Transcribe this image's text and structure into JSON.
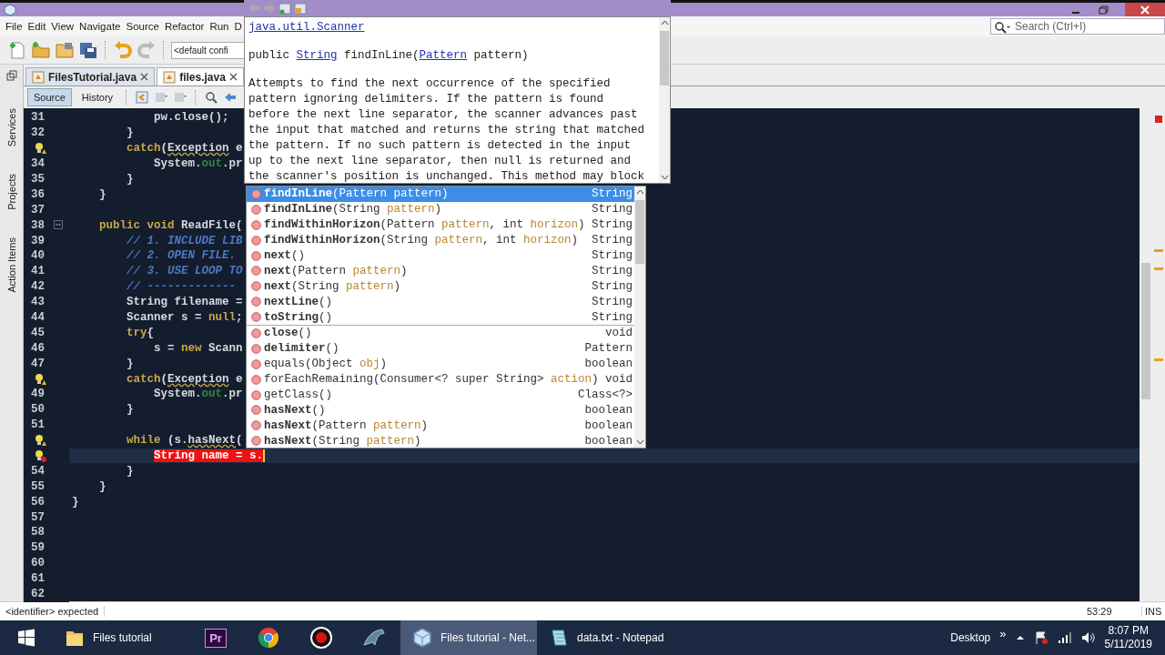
{
  "menu": [
    "File",
    "Edit",
    "View",
    "Navigate",
    "Source",
    "Refactor",
    "Run",
    "D"
  ],
  "toolbar": {
    "config": "<default confi"
  },
  "search": {
    "placeholder": "Search (Ctrl+I)"
  },
  "side_tabs": [
    "Services",
    "Projects",
    "Action Items"
  ],
  "editor_tabs": [
    {
      "label": "FilesTutorial.java",
      "selected": false
    },
    {
      "label": "files.java",
      "selected": true
    }
  ],
  "view_tabs": [
    {
      "label": "Source",
      "selected": true
    },
    {
      "label": "History",
      "selected": false
    }
  ],
  "code_lines": [
    {
      "number": "31",
      "tokens": [
        {
          "kind": "plain",
          "text": "            pw.close();"
        }
      ]
    },
    {
      "number": "32",
      "tokens": [
        {
          "kind": "plain",
          "text": "        }"
        }
      ]
    },
    {
      "warning": true,
      "tokens": [
        {
          "kind": "keyword",
          "text": "        catch"
        },
        {
          "kind": "plain",
          "text": "("
        },
        {
          "kind": "squiggle",
          "text": "Exception"
        },
        {
          "kind": "plain",
          "text": " e"
        }
      ]
    },
    {
      "number": "34",
      "tokens": [
        {
          "kind": "plain",
          "text": "            System."
        },
        {
          "kind": "field",
          "text": "out"
        },
        {
          "kind": "plain",
          "text": ".pr"
        }
      ]
    },
    {
      "number": "35",
      "tokens": [
        {
          "kind": "plain",
          "text": "        }"
        }
      ]
    },
    {
      "number": "36",
      "tokens": [
        {
          "kind": "plain",
          "text": "    }"
        }
      ]
    },
    {
      "number": "37"
    },
    {
      "number": "38",
      "fold": true,
      "tokens": [
        {
          "kind": "keyword",
          "text": "    public void"
        },
        {
          "kind": "plain",
          "text": " ReadFile("
        }
      ]
    },
    {
      "number": "39",
      "tokens": [
        {
          "kind": "comment",
          "text": "        // 1. INCLUDE LIB"
        }
      ]
    },
    {
      "number": "40",
      "tokens": [
        {
          "kind": "comment",
          "text": "        // 2. OPEN FILE."
        }
      ]
    },
    {
      "number": "41",
      "tokens": [
        {
          "kind": "comment",
          "text": "        // 3. USE LOOP TO"
        }
      ]
    },
    {
      "number": "42",
      "tokens": [
        {
          "kind": "comment",
          "text": "        // -------------"
        }
      ]
    },
    {
      "number": "43",
      "tokens": [
        {
          "kind": "plain",
          "text": "        String filename ="
        }
      ]
    },
    {
      "number": "44",
      "tokens": [
        {
          "kind": "plain",
          "text": "        Scanner s = "
        },
        {
          "kind": "keyword",
          "text": "null"
        },
        {
          "kind": "plain",
          "text": ";"
        }
      ]
    },
    {
      "number": "45",
      "tokens": [
        {
          "kind": "keyword",
          "text": "        try"
        },
        {
          "kind": "plain",
          "text": "{"
        }
      ]
    },
    {
      "number": "46",
      "tokens": [
        {
          "kind": "plain",
          "text": "            s = "
        },
        {
          "kind": "keyword",
          "text": "new"
        },
        {
          "kind": "plain",
          "text": " Scann"
        }
      ]
    },
    {
      "number": "47",
      "tokens": [
        {
          "kind": "plain",
          "text": "        }"
        }
      ]
    },
    {
      "warning": true,
      "tokens": [
        {
          "kind": "keyword",
          "text": "        catch"
        },
        {
          "kind": "plain",
          "text": "("
        },
        {
          "kind": "squiggle",
          "text": "Exception"
        },
        {
          "kind": "plain",
          "text": " e"
        }
      ]
    },
    {
      "number": "49",
      "tokens": [
        {
          "kind": "plain",
          "text": "            System."
        },
        {
          "kind": "field",
          "text": "out"
        },
        {
          "kind": "plain",
          "text": ".pr"
        }
      ]
    },
    {
      "number": "50",
      "tokens": [
        {
          "kind": "plain",
          "text": "        }"
        }
      ]
    },
    {
      "number": "51"
    },
    {
      "warning": true,
      "tokens": [
        {
          "kind": "keyword",
          "text": "        while"
        },
        {
          "kind": "plain",
          "text": " (s."
        },
        {
          "kind": "squiggle",
          "text": "hasNext"
        },
        {
          "kind": "plain",
          "text": "("
        }
      ]
    },
    {
      "error": true,
      "current": true,
      "tokens": [
        {
          "kind": "error",
          "text": "String name = s."
        }
      ]
    },
    {
      "number": "54",
      "tokens": [
        {
          "kind": "plain",
          "text": "        }"
        }
      ]
    },
    {
      "number": "55",
      "tokens": [
        {
          "kind": "plain",
          "text": "    }"
        }
      ]
    },
    {
      "number": "56",
      "tokens": [
        {
          "kind": "plain",
          "text": "}"
        }
      ]
    },
    {
      "number": "57"
    },
    {
      "number": "58"
    },
    {
      "number": "59"
    },
    {
      "number": "60"
    },
    {
      "number": "61"
    },
    {
      "number": "62"
    }
  ],
  "javadoc": {
    "class_link": "java.util.Scanner",
    "signature": [
      {
        "kind": "plain",
        "text": "public "
      },
      {
        "kind": "link",
        "text": "String"
      },
      {
        "kind": "plain",
        "text": " findInLine("
      },
      {
        "kind": "link",
        "text": "Pattern"
      },
      {
        "kind": "plain",
        "text": " pattern)"
      }
    ],
    "description": "Attempts to find the next occurrence of the specified pattern ignoring delimiters. If the pattern is found before the next line separator, the scanner advances past the input that matched and returns the string that matched the pattern. If no such pattern is detected in the input up to the next line separator, then null is returned and the scanner's position is unchanged. This method may block"
  },
  "completion": {
    "groups": [
      [
        {
          "selected": true,
          "inherited": false,
          "returns": "String",
          "parts": [
            {
              "kind": "name",
              "text": "findInLine"
            },
            {
              "kind": "plain",
              "text": "(Pattern "
            },
            {
              "kind": "param",
              "text": "pattern"
            },
            {
              "kind": "plain",
              "text": ")"
            }
          ]
        },
        {
          "selected": false,
          "inherited": false,
          "returns": "String",
          "parts": [
            {
              "kind": "name",
              "text": "findInLine"
            },
            {
              "kind": "plain",
              "text": "(String "
            },
            {
              "kind": "param",
              "text": "pattern"
            },
            {
              "kind": "plain",
              "text": ")"
            }
          ]
        },
        {
          "selected": false,
          "inherited": false,
          "returns": "String",
          "parts": [
            {
              "kind": "name",
              "text": "findWithinHorizon"
            },
            {
              "kind": "plain",
              "text": "(Pattern "
            },
            {
              "kind": "param",
              "text": "pattern"
            },
            {
              "kind": "plain",
              "text": ", int "
            },
            {
              "kind": "param",
              "text": "horizon"
            },
            {
              "kind": "plain",
              "text": ")"
            }
          ]
        },
        {
          "selected": false,
          "inherited": false,
          "returns": "String",
          "parts": [
            {
              "kind": "name",
              "text": "findWithinHorizon"
            },
            {
              "kind": "plain",
              "text": "(String "
            },
            {
              "kind": "param",
              "text": "pattern"
            },
            {
              "kind": "plain",
              "text": ", int "
            },
            {
              "kind": "param",
              "text": "horizon"
            },
            {
              "kind": "plain",
              "text": ")"
            }
          ]
        },
        {
          "selected": false,
          "inherited": false,
          "returns": "String",
          "parts": [
            {
              "kind": "name",
              "text": "next"
            },
            {
              "kind": "plain",
              "text": "()"
            }
          ]
        },
        {
          "selected": false,
          "inherited": false,
          "returns": "String",
          "parts": [
            {
              "kind": "name",
              "text": "next"
            },
            {
              "kind": "plain",
              "text": "(Pattern "
            },
            {
              "kind": "param",
              "text": "pattern"
            },
            {
              "kind": "plain",
              "text": ")"
            }
          ]
        },
        {
          "selected": false,
          "inherited": false,
          "returns": "String",
          "parts": [
            {
              "kind": "name",
              "text": "next"
            },
            {
              "kind": "plain",
              "text": "(String "
            },
            {
              "kind": "param",
              "text": "pattern"
            },
            {
              "kind": "plain",
              "text": ")"
            }
          ]
        },
        {
          "selected": false,
          "inherited": false,
          "returns": "String",
          "parts": [
            {
              "kind": "name",
              "text": "nextLine"
            },
            {
              "kind": "plain",
              "text": "()"
            }
          ]
        },
        {
          "selected": false,
          "inherited": false,
          "returns": "String",
          "parts": [
            {
              "kind": "name",
              "text": "toString"
            },
            {
              "kind": "plain",
              "text": "()"
            }
          ]
        }
      ],
      [
        {
          "selected": false,
          "inherited": false,
          "returns": "void",
          "parts": [
            {
              "kind": "name",
              "text": "close"
            },
            {
              "kind": "plain",
              "text": "()"
            }
          ]
        },
        {
          "selected": false,
          "inherited": false,
          "returns": "Pattern",
          "parts": [
            {
              "kind": "name",
              "text": "delimiter"
            },
            {
              "kind": "plain",
              "text": "()"
            }
          ]
        },
        {
          "selected": false,
          "inherited": true,
          "returns": "boolean",
          "parts": [
            {
              "kind": "name",
              "text": "equals"
            },
            {
              "kind": "plain",
              "text": "(Object "
            },
            {
              "kind": "param",
              "text": "obj"
            },
            {
              "kind": "plain",
              "text": ")"
            }
          ]
        },
        {
          "selected": false,
          "inherited": true,
          "returns": "void",
          "parts": [
            {
              "kind": "name",
              "text": "forEachRemaining"
            },
            {
              "kind": "plain",
              "text": "(Consumer<? super String> "
            },
            {
              "kind": "param",
              "text": "action"
            },
            {
              "kind": "plain",
              "text": ")"
            }
          ]
        },
        {
          "selected": false,
          "inherited": true,
          "returns": "Class<?>",
          "parts": [
            {
              "kind": "name",
              "text": "getClass"
            },
            {
              "kind": "plain",
              "text": "()"
            }
          ]
        },
        {
          "selected": false,
          "inherited": false,
          "returns": "boolean",
          "parts": [
            {
              "kind": "name",
              "text": "hasNext"
            },
            {
              "kind": "plain",
              "text": "()"
            }
          ]
        },
        {
          "selected": false,
          "inherited": false,
          "returns": "boolean",
          "parts": [
            {
              "kind": "name",
              "text": "hasNext"
            },
            {
              "kind": "plain",
              "text": "(Pattern "
            },
            {
              "kind": "param",
              "text": "pattern"
            },
            {
              "kind": "plain",
              "text": ")"
            }
          ]
        },
        {
          "selected": false,
          "inherited": false,
          "returns": "boolean",
          "parts": [
            {
              "kind": "name",
              "text": "hasNext"
            },
            {
              "kind": "plain",
              "text": "(String "
            },
            {
              "kind": "param",
              "text": "pattern"
            },
            {
              "kind": "plain",
              "text": ")"
            }
          ]
        }
      ]
    ]
  },
  "status_bar": {
    "message": "<identifier> expected",
    "position": "53:29",
    "mode": "INS"
  },
  "taskbar": {
    "items": [
      {
        "kind": "start",
        "selected": false
      },
      {
        "kind": "folder",
        "label": "Files tutorial",
        "selected": false
      },
      {
        "kind": "premiere",
        "label": "Pr",
        "selected": false
      },
      {
        "kind": "chrome",
        "selected": false
      },
      {
        "kind": "record",
        "selected": false
      },
      {
        "kind": "mysql",
        "selected": false
      },
      {
        "kind": "netbeans",
        "label": "Files tutorial - Net...",
        "selected": true
      },
      {
        "kind": "notepad",
        "label": "data.txt - Notepad",
        "selected": false
      }
    ],
    "desktop": "Desktop",
    "expand": "»",
    "time": "8:07 PM",
    "date": "5/11/2019"
  }
}
